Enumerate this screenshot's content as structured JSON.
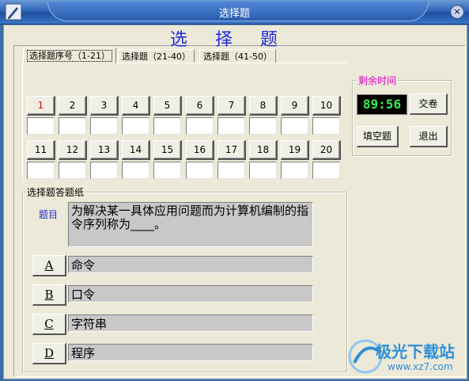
{
  "window": {
    "title": "选择题",
    "close_label": "×"
  },
  "main_title": "选 择 题",
  "tabs": [
    {
      "label": "选择题序号（1-21）"
    },
    {
      "label": "选择题（21-40）"
    },
    {
      "label": "选择题（41-50）"
    }
  ],
  "questions_row1": [
    "1",
    "2",
    "3",
    "4",
    "5",
    "6",
    "7",
    "8",
    "9",
    "10"
  ],
  "questions_row2": [
    "11",
    "12",
    "13",
    "14",
    "15",
    "16",
    "17",
    "18",
    "19",
    "20"
  ],
  "time_panel": {
    "label": "剩余时间",
    "time": "89:56",
    "submit_label": "交卷",
    "fill_blank_label": "填空题",
    "exit_label": "退出"
  },
  "answer_sheet": {
    "label": "选择题答题纸",
    "question_label": "题目",
    "question_text": "为解决某一具体应用问题而为计算机编制的指令序列称为____。",
    "options": [
      {
        "key": "A",
        "text": "命令"
      },
      {
        "key": "B",
        "text": "口令"
      },
      {
        "key": "C",
        "text": "字符串"
      },
      {
        "key": "D",
        "text": "程序"
      }
    ]
  },
  "watermark": {
    "name": "极光下载站",
    "url": "www.xz7.com"
  }
}
